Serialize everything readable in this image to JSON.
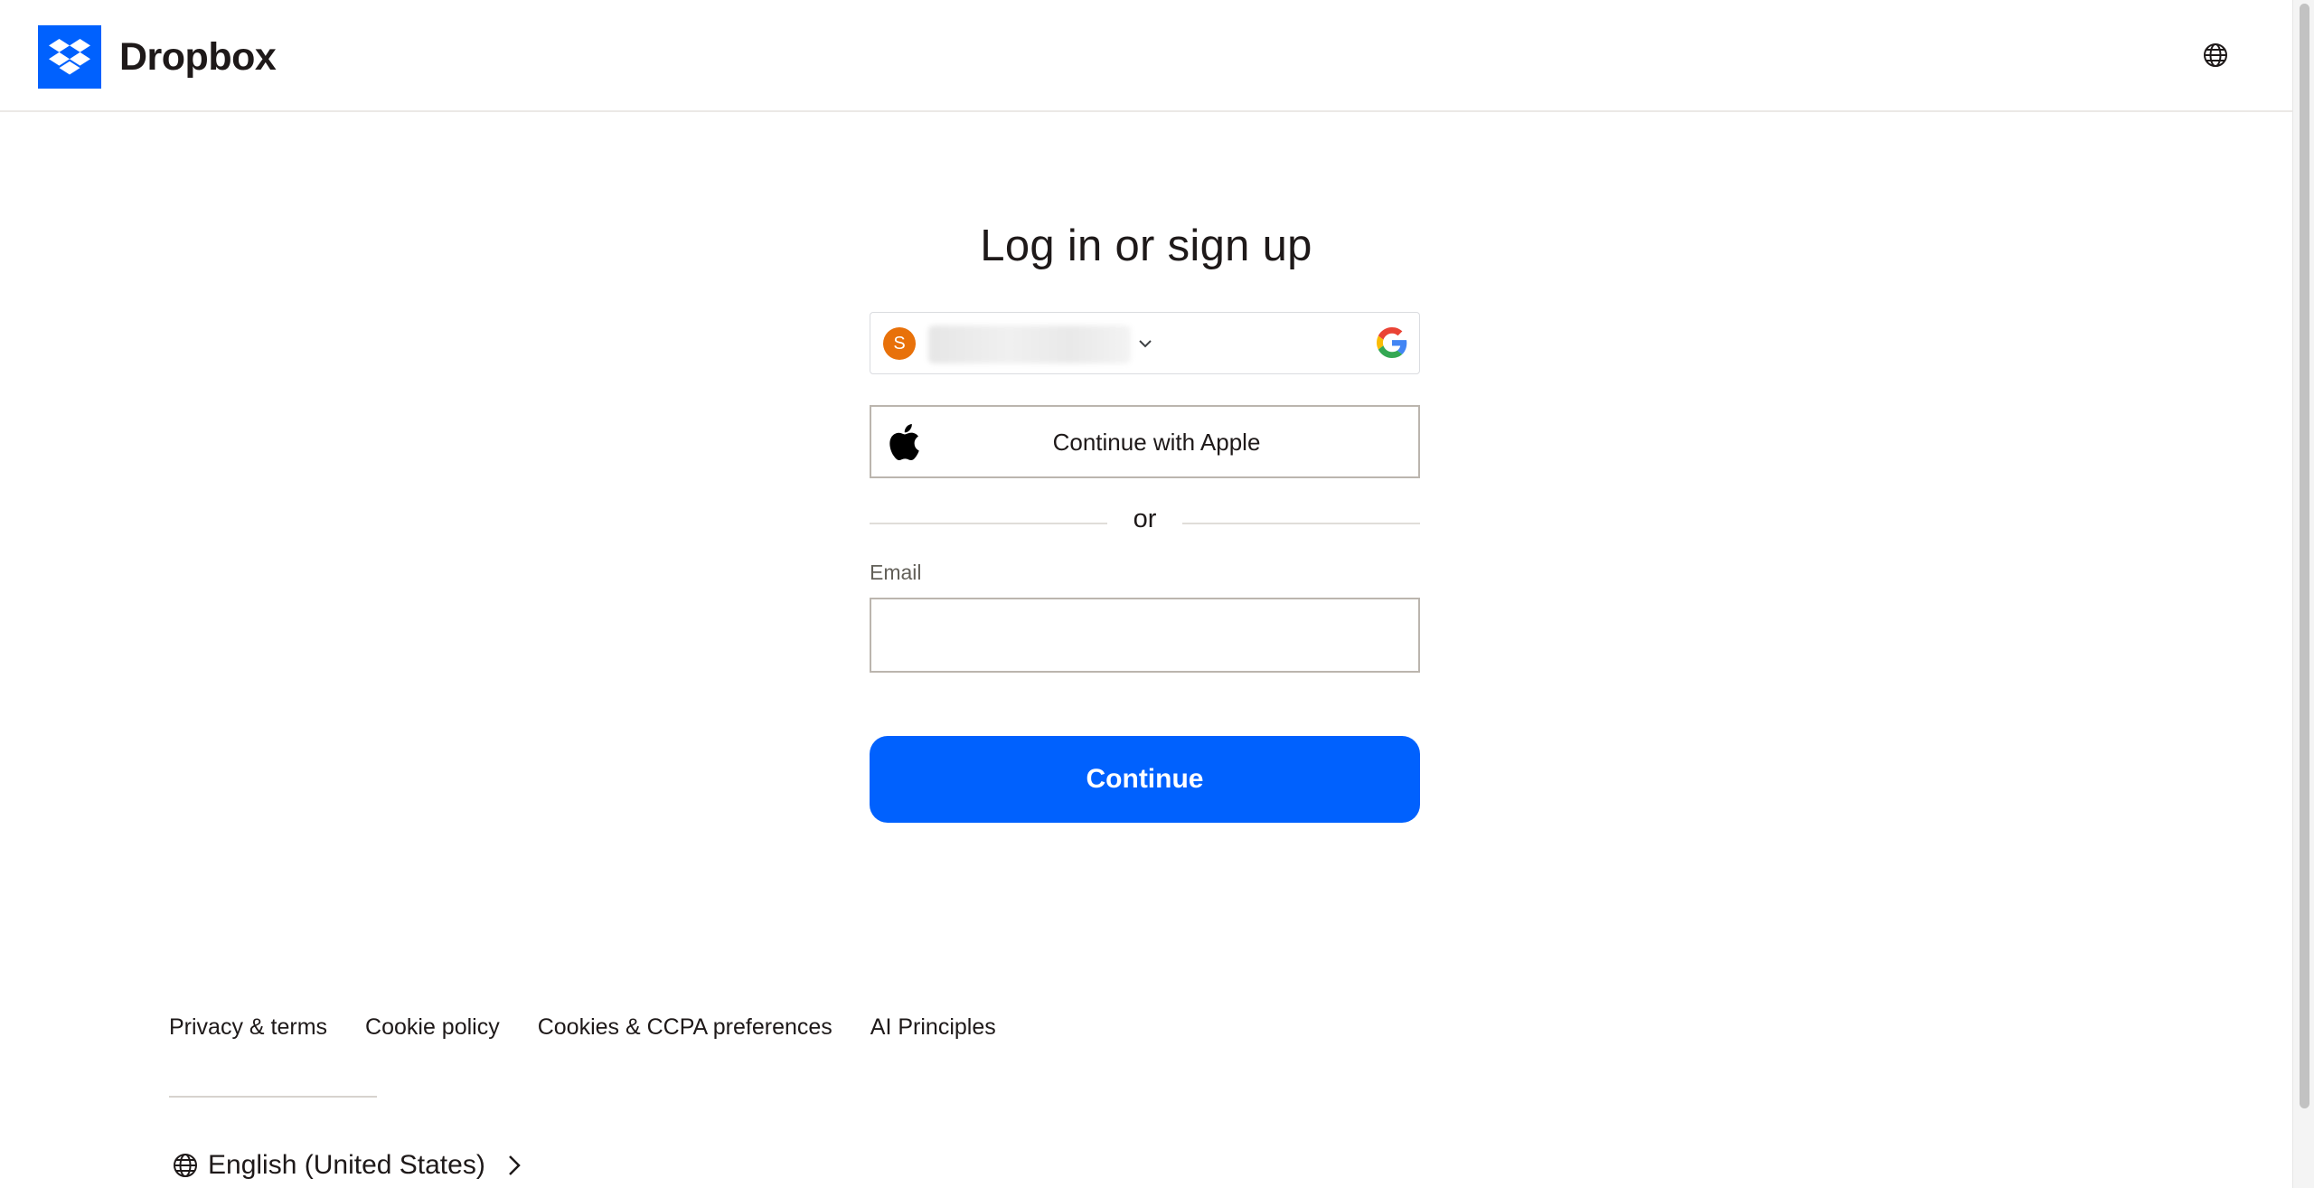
{
  "header": {
    "brand": "Dropbox",
    "logo_icon": "dropbox-logo-icon",
    "language_icon": "globe-icon"
  },
  "main": {
    "title": "Log in or sign up",
    "google_account": {
      "avatar_initial": "S",
      "avatar_color": "#e8710a",
      "account_text_blurred": true,
      "icon": "google-g-icon",
      "expand_icon": "chevron-down-icon"
    },
    "apple_button_label": "Continue with Apple",
    "apple_icon": "apple-icon",
    "separator": "or",
    "email_label": "Email",
    "email_value": "",
    "continue_label": "Continue"
  },
  "footer": {
    "links": [
      "Privacy & terms",
      "Cookie policy",
      "Cookies & CCPA preferences",
      "AI Principles"
    ],
    "language_label": "English (United States)",
    "language_icon": "globe-icon",
    "language_chevron": "chevron-right-icon"
  },
  "colors": {
    "accent": "#0061fe",
    "text": "#1e1919",
    "muted": "#636059",
    "border": "#bbb5ae"
  }
}
